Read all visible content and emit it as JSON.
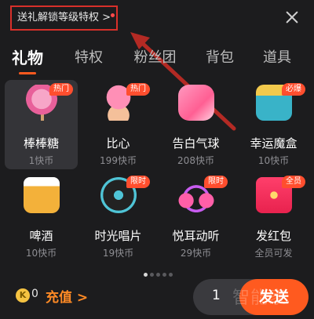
{
  "header": {
    "promo_text": "送礼解锁等级特权 >",
    "close_icon": "close-icon"
  },
  "tabs": [
    {
      "label": "礼物",
      "active": true
    },
    {
      "label": "特权",
      "active": false
    },
    {
      "label": "粉丝团",
      "active": false
    },
    {
      "label": "背包",
      "active": false
    },
    {
      "label": "道具",
      "active": false
    }
  ],
  "gifts": [
    {
      "name": "棒棒糖",
      "price": "1快币",
      "badge": "热门",
      "icon": "lollipop-icon",
      "color": "#e8609a",
      "selected": true
    },
    {
      "name": "比心",
      "price": "199快币",
      "badge": "热门",
      "icon": "heart-hand-icon",
      "color": "#ff7aa8",
      "selected": false
    },
    {
      "name": "告白气球",
      "price": "208快币",
      "badge": "",
      "icon": "love-balloon-icon",
      "color": "#ff6fa0",
      "selected": false
    },
    {
      "name": "幸运魔盒",
      "price": "10快币",
      "badge": "必爆",
      "icon": "treasure-box-icon",
      "color": "#39b3c8",
      "selected": false
    },
    {
      "name": "啤酒",
      "price": "10快币",
      "badge": "",
      "icon": "beer-icon",
      "color": "#f3b13a",
      "selected": false
    },
    {
      "name": "时光唱片",
      "price": "19快币",
      "badge": "限时",
      "icon": "vinyl-record-icon",
      "color": "#4fc4d6",
      "selected": false
    },
    {
      "name": "悦耳动听",
      "price": "29快币",
      "badge": "限时",
      "icon": "headphones-icon",
      "color": "#c85cf0",
      "selected": false
    },
    {
      "name": "发红包",
      "price": "全员可发",
      "badge": "全员",
      "icon": "red-envelope-icon",
      "color": "#ff3f6b",
      "selected": false
    }
  ],
  "pagination": {
    "page_count": 5,
    "current_page": 1
  },
  "footer": {
    "coin_symbol": "K",
    "balance": "0",
    "recharge_label": "充值 >",
    "quantity": "1",
    "send_label": "发送",
    "watermark": "智能家"
  }
}
